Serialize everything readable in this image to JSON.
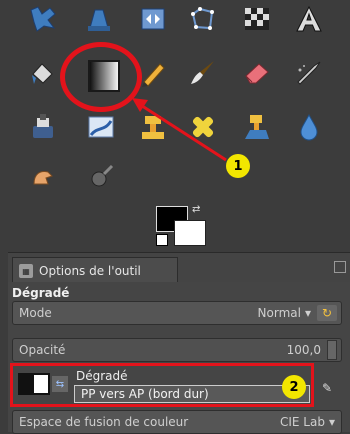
{
  "tool_options": {
    "tab_label": "Options de l'outil",
    "section_title": "Dégradé",
    "mode": {
      "label": "Mode",
      "value": "Normal"
    },
    "opacity": {
      "label": "Opacité",
      "value": "100,0"
    },
    "gradient": {
      "label": "Dégradé",
      "value": "PP vers AP (bord dur)"
    },
    "color_space": {
      "label": "Espace de fusion de couleur",
      "value": "CIE Lab"
    }
  },
  "annotations": {
    "badge1": "1",
    "badge2": "2",
    "accent_color": "#e3131b",
    "badge_color": "#f2e600"
  },
  "icons": {
    "row1": [
      "path-tool-icon",
      "unified-transform-icon",
      "flip-tool-icon",
      "cage-transform-icon",
      "warp-transform-icon",
      "text-tool-icon"
    ],
    "row2": [
      "bucket-fill-icon",
      "gradient-tool-icon",
      "pencil-tool-icon",
      "paintbrush-tool-icon",
      "eraser-tool-icon",
      "airbrush-tool-icon"
    ],
    "row3": [
      "ink-tool-icon",
      "mypaint-brush-icon",
      "clone-tool-icon",
      "healing-tool-icon",
      "perspective-clone-icon",
      "blur-tool-icon"
    ],
    "row4": [
      "smudge-tool-icon",
      "dodge-burn-icon"
    ]
  }
}
